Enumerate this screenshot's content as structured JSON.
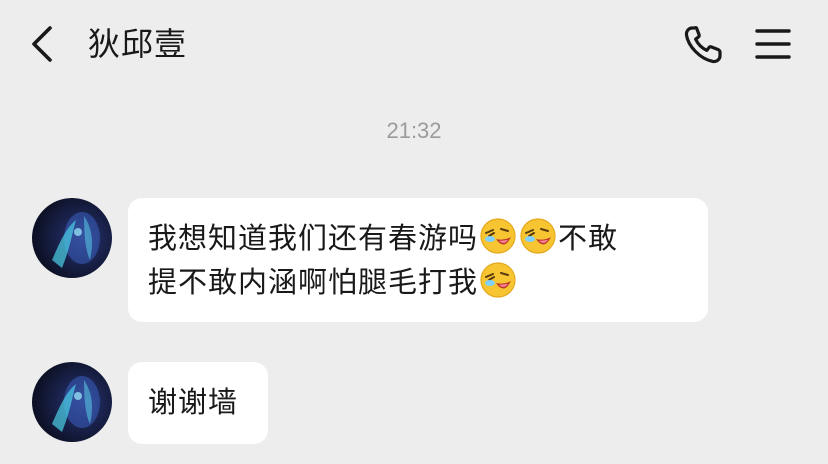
{
  "header": {
    "title": "狄邱壹",
    "back_icon": "chevron-left-icon",
    "call_icon": "phone-icon",
    "menu_icon": "hamburger-menu-icon"
  },
  "timestamp": "21:32",
  "messages": [
    {
      "sender": "other",
      "line1_before": "我想知道我们还有春游吗",
      "line1_after": "不敢",
      "line2": "提不敢内涵啊怕腿毛打我",
      "emoji": "laughing-tears-emoji"
    },
    {
      "sender": "other",
      "text": "谢谢墙"
    }
  ],
  "colors": {
    "background": "#ededed",
    "bubble": "#ffffff",
    "text": "#191919",
    "timestamp": "#9b9b9b"
  }
}
